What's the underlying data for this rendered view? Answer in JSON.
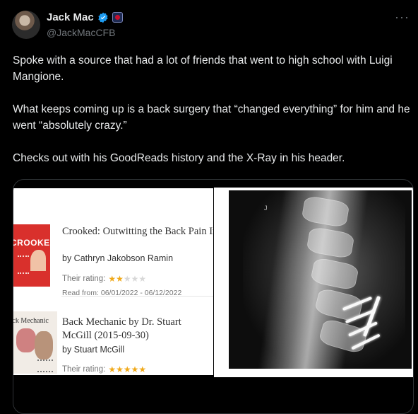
{
  "author": {
    "name": "Jack Mac",
    "handle": "@JackMacCFB",
    "verified_color": "#1d9bf0"
  },
  "more_label": "···",
  "tweet": {
    "paragraphs": [
      "Spoke with a source that had a lot of friends that went to high school with Luigi Mangione.",
      "What keeps coming up is a back surgery that “changed everything” for him and he went “absolutely crazy.”",
      "Checks out with his GoodReads history and the X-Ray in his header."
    ]
  },
  "media": {
    "books": [
      {
        "cover_text": "CROOKED",
        "title": "Crooked: Outwitting the Back Pain Industry and Getting on t",
        "author": "by Cathryn Jakobson Ramin",
        "rating_label": "Their rating:",
        "rating": 2,
        "rating_max": 5,
        "read_from": "Read from: 06/01/2022 - 06/12/2022"
      },
      {
        "cover_text": "ack Mechanic",
        "title": "Back Mechanic by Dr. Stuart McGill (2015-09-30)",
        "author": "by Stuart McGill",
        "rating_label": "Their rating:",
        "rating": 5,
        "rating_max": 5
      }
    ],
    "xray_marker": "J"
  }
}
